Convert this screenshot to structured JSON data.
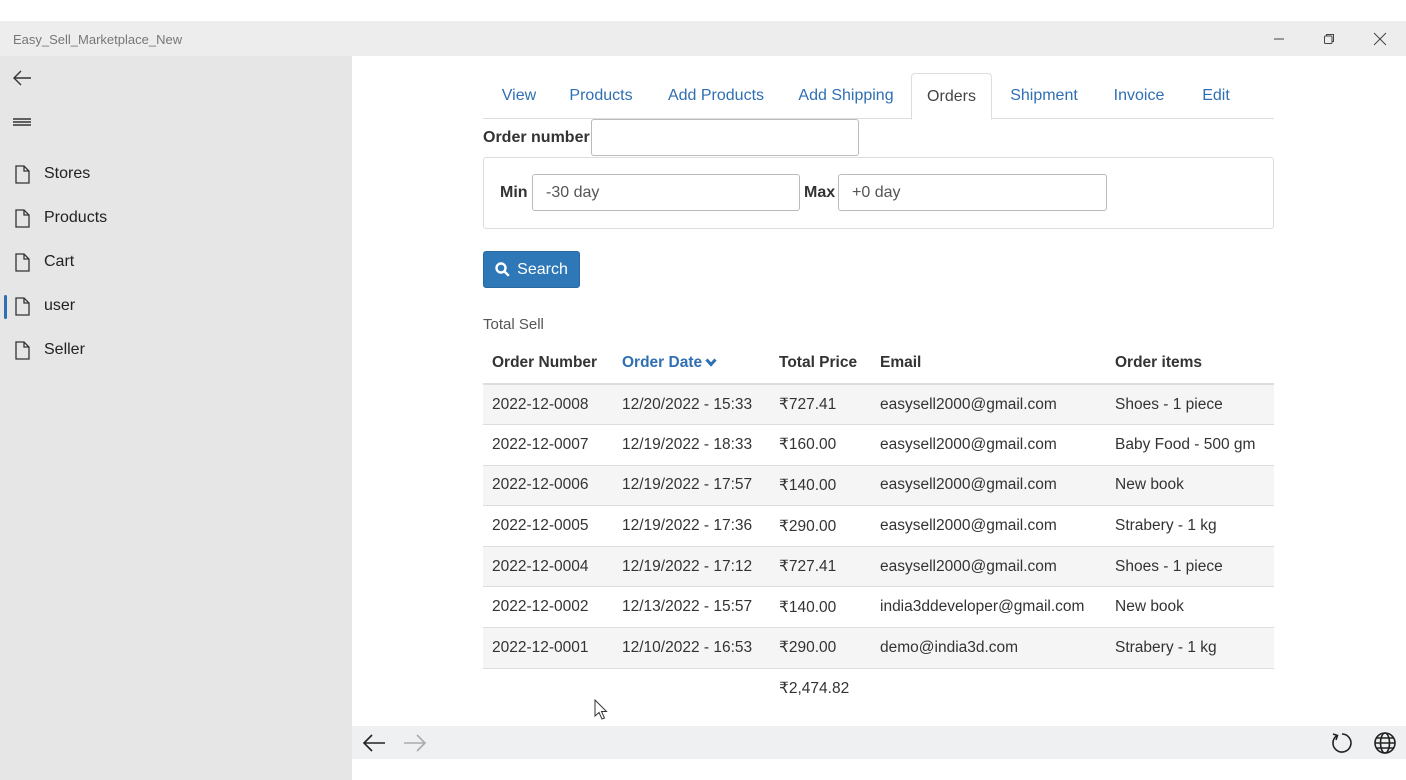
{
  "window": {
    "title": "Easy_Sell_Marketplace_New"
  },
  "sidebar": {
    "items": [
      {
        "label": "Stores",
        "icon": "file-icon",
        "active": false
      },
      {
        "label": "Products",
        "icon": "file-icon",
        "active": false
      },
      {
        "label": "Cart",
        "icon": "file-icon",
        "active": false
      },
      {
        "label": "user",
        "icon": "file-icon",
        "active": true
      },
      {
        "label": "Seller",
        "icon": "file-icon",
        "active": false
      }
    ]
  },
  "tabs": [
    "View",
    "Products",
    "Add Products",
    "Add Shipping",
    "Orders",
    "Shipment",
    "Invoice",
    "Edit"
  ],
  "active_tab": "Orders",
  "filters": {
    "order_number_label": "Order number",
    "order_number_value": "",
    "min_label": "Min",
    "min_value": "-30 day",
    "max_label": "Max",
    "max_value": "+0 day"
  },
  "search_button": "Search",
  "total_sell_label": "Total Sell",
  "table": {
    "headers": [
      "Order Number",
      "Order Date",
      "Total Price",
      "Email",
      "Order items"
    ],
    "sorted_column": "Order Date",
    "rows": [
      [
        "2022-12-0008",
        "12/20/2022 - 15:33",
        "₹727.41",
        "easysell2000@gmail.com",
        "Shoes - 1 piece"
      ],
      [
        "2022-12-0007",
        "12/19/2022 - 18:33",
        "₹160.00",
        "easysell2000@gmail.com",
        "Baby Food - 500 gm"
      ],
      [
        "2022-12-0006",
        "12/19/2022 - 17:57",
        "₹140.00",
        "easysell2000@gmail.com",
        "New book"
      ],
      [
        "2022-12-0005",
        "12/19/2022 - 17:36",
        "₹290.00",
        "easysell2000@gmail.com",
        "Strabery - 1 kg"
      ],
      [
        "2022-12-0004",
        "12/19/2022 - 17:12",
        "₹727.41",
        "easysell2000@gmail.com",
        "Shoes - 1 piece"
      ],
      [
        "2022-12-0002",
        "12/13/2022 - 15:57",
        "₹140.00",
        "india3ddeveloper@gmail.com",
        "New book"
      ],
      [
        "2022-12-0001",
        "12/10/2022 - 16:53",
        "₹290.00",
        "demo@india3d.com",
        "Strabery - 1 kg"
      ]
    ],
    "total": "₹2,474.82"
  },
  "colors": {
    "link": "#2f6fb3",
    "button": "#2f78b7",
    "sidebar_bg": "#e6e6e6"
  }
}
